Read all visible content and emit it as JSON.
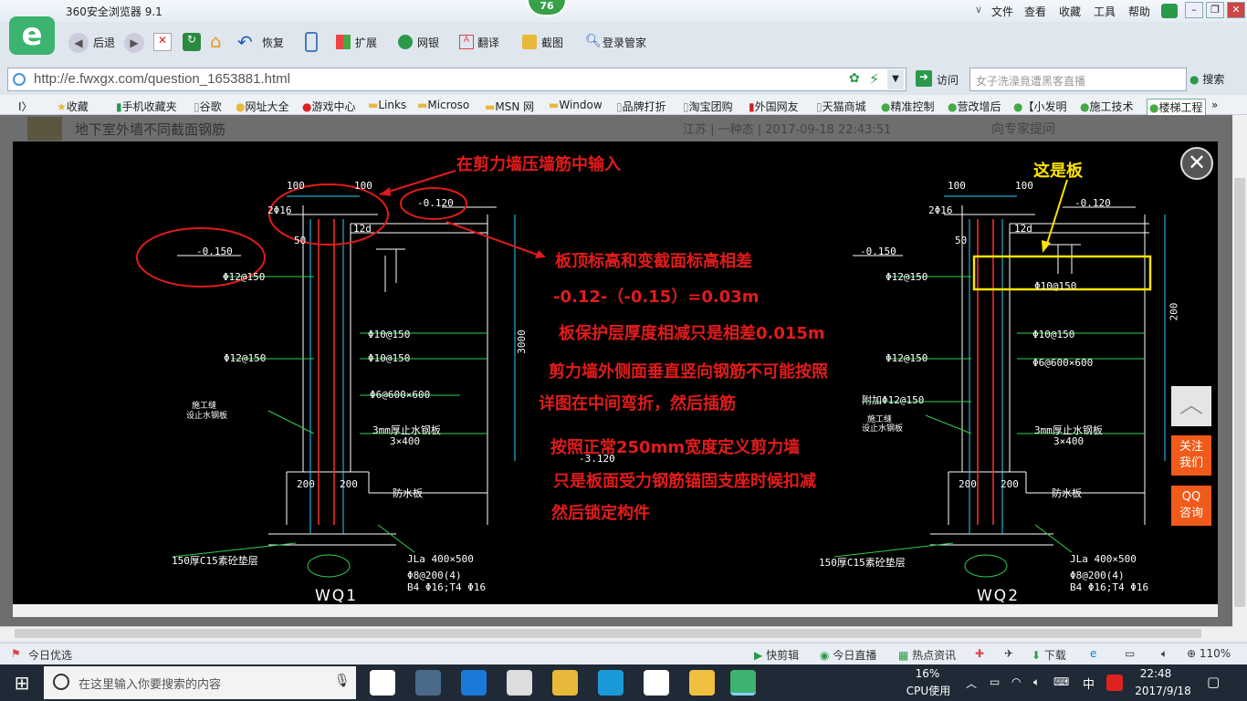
{
  "browser": {
    "title": "360安全浏览器 9.1",
    "badge": "76",
    "menus": [
      "文件",
      "查看",
      "收藏",
      "工具",
      "帮助"
    ],
    "toolbar": {
      "back": "后退",
      "restore": "恢复",
      "extend": "扩展",
      "netbank": "网银",
      "translate": "翻译",
      "screenshot": "截图",
      "login": "登录管家"
    },
    "url": "http://e.fwxgx.com/question_1653881.html",
    "go": "访问",
    "search_placeholder": "女子洗澡竟遭黑客直播",
    "search_btn": "搜索",
    "favorites": [
      "收藏",
      "手机收藏夹",
      "谷歌",
      "网址大全",
      "游戏中心",
      "Links",
      "Microso",
      "MSN 网",
      "Window",
      "品牌打折",
      "淘宝团购",
      "外国网友",
      "天猫商城",
      "精准控制",
      "营改增后",
      "【小发明",
      "施工技术",
      "楼梯工程"
    ]
  },
  "page_bg": {
    "title": "地下室外墙不同截面钢筋",
    "meta": "江苏 | 一种态 | 2017-09-18 22:43:51",
    "right": "向专家提问"
  },
  "annotations": {
    "a1": "在剪力墙压墙筋中输入",
    "a2": "板顶标高和变截面标高相差",
    "a3": "-0.12-（-0.15）=0.03m",
    "a4": "板保护层厚度相减只是相差0.015m",
    "a5": "剪力墙外侧面垂直竖向钢筋不可能按照",
    "a6": "详图在中间弯折，然后插筋",
    "a7": "按照正常250mm宽度定义剪力墙",
    "a8": "只是板面受力钢筋锚固支座时候扣减",
    "a9": "然后锁定构件",
    "a10": "这是板"
  },
  "drawing": {
    "wq1": {
      "dim_top": [
        "100",
        "100"
      ],
      "rebar_top": "2Φ16",
      "elev_a": "-0.120",
      "elev_b": "-0.150",
      "len": "12d",
      "v50": "50",
      "r1": "Φ12@150",
      "r2": "Φ10@150",
      "r3": "Φ12@150",
      "r4": "Φ10@150",
      "r5": "Φ6@600×600",
      "joint": "施工缝",
      "waterstop": "设止水钢板",
      "plate": "3mm厚止水钢板",
      "plate_size": "3×400",
      "elev_c": "-3.120",
      "base_dims": [
        "200",
        "200"
      ],
      "slab": "防水板",
      "cushion": "150厚C15素砼垫层",
      "beam": "JLa 400×500",
      "stirrup": "Φ8@200(4)",
      "bars": "B4 Φ16;T4 Φ16",
      "vdim": "3000",
      "name": "WQ1"
    },
    "wq2": {
      "dim_top": [
        "100",
        "100"
      ],
      "rebar_top": "2Φ16",
      "elev_a": "-0.120",
      "elev_b": "-0.150",
      "len": "12d",
      "v50": "50",
      "r1": "Φ12@150",
      "r2": "Φ10@150",
      "r3": "Φ10@150",
      "r4": "Φ12@150",
      "r5": "Φ6@600×600",
      "extra": "附加Φ12@150",
      "joint": "施工缝",
      "waterstop": "设止水钢板",
      "plate": "3mm厚止水钢板",
      "plate_size": "3×400",
      "base_dims": [
        "200",
        "200"
      ],
      "slab": "防水板",
      "cushion": "150厚C15素砼垫层",
      "beam": "JLa 400×500",
      "stirrup": "Φ8@200(4)",
      "bars": "B4 Φ16;T4 Φ16",
      "vdim": "200",
      "name": "WQ2"
    }
  },
  "side": {
    "follow": "关注\n我们",
    "qq": "QQ\n咨询"
  },
  "status": {
    "left": "今日优选",
    "items": [
      "快剪辑",
      "今日直播",
      "热点资讯",
      "下载"
    ],
    "zoom": "110%"
  },
  "taskbar": {
    "search": "在这里输入你要搜索的内容",
    "cpu": "16%",
    "cpu_label": "CPU使用",
    "ime": "中",
    "time": "22:48",
    "date": "2017/9/18"
  }
}
